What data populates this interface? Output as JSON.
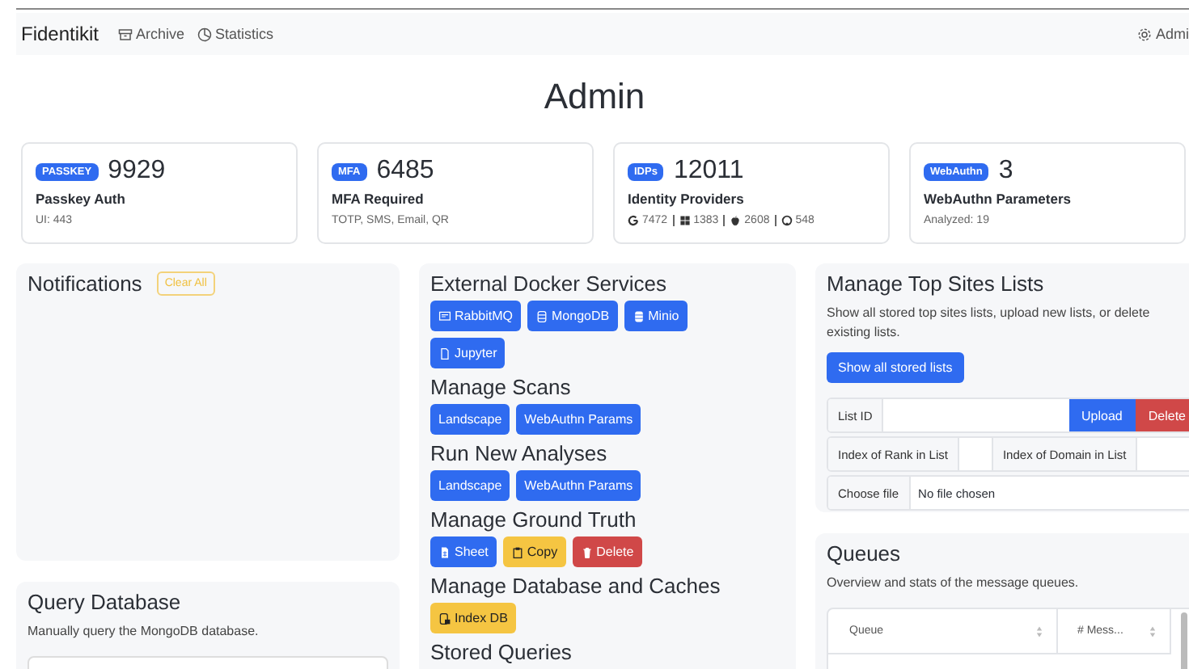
{
  "nav": {
    "brand": "Fidentikit",
    "links": [
      {
        "label": "Archive"
      },
      {
        "label": "Statistics"
      }
    ],
    "user": {
      "label": "Admi"
    }
  },
  "title": "Admin",
  "stats": [
    {
      "badge": "PASSKEY",
      "value": "9929",
      "label": "Passkey Auth",
      "sub": {
        "kind": "text",
        "text": "UI: 443"
      }
    },
    {
      "badge": "MFA",
      "value": "6485",
      "label": "MFA Required",
      "sub": {
        "kind": "text",
        "text": "TOTP, SMS, Email, QR"
      }
    },
    {
      "badge": "IDPs",
      "value": "12011",
      "label": "Identity Providers",
      "sub": {
        "kind": "providers",
        "items": [
          {
            "count": "7472"
          },
          {
            "count": "1383"
          },
          {
            "count": "2608"
          },
          {
            "count": "548"
          }
        ]
      }
    },
    {
      "badge": "WebAuthn",
      "value": "3",
      "label": "WebAuthn Parameters",
      "sub": {
        "kind": "text",
        "text": "Analyzed: 19"
      }
    }
  ],
  "notifications": {
    "title": "Notifications",
    "clear_button": "Clear All"
  },
  "query_db": {
    "title": "Query Database",
    "description": "Manually query the MongoDB database."
  },
  "sections": [
    {
      "title": "External Docker Services",
      "buttons": [
        {
          "label": "RabbitMQ"
        },
        {
          "label": "MongoDB"
        },
        {
          "label": "Minio"
        },
        {
          "label": "Jupyter"
        }
      ]
    },
    {
      "title": "Manage Scans",
      "buttons": [
        {
          "label": "Landscape"
        },
        {
          "label": "WebAuthn Params"
        }
      ]
    },
    {
      "title": "Run New Analyses",
      "buttons": [
        {
          "label": "Landscape"
        },
        {
          "label": "WebAuthn Params"
        }
      ]
    },
    {
      "title": "Manage Ground Truth",
      "buttons": [
        {
          "label": "Sheet"
        },
        {
          "label": "Copy"
        },
        {
          "label": "Delete"
        }
      ]
    },
    {
      "title": "Manage Database and Caches",
      "buttons": [
        {
          "label": "Index DB"
        }
      ]
    },
    {
      "title": "Stored Queries"
    }
  ],
  "top_sites": {
    "title": "Manage Top Sites Lists",
    "description": "Show all stored top sites lists, upload new lists, or delete existing lists.",
    "show_button": "Show all stored lists",
    "list_id_label": "List ID",
    "upload_button": "Upload",
    "delete_button": "Delete",
    "rank_label": "Index of Rank in List",
    "domain_label": "Index of Domain in List",
    "choose_file": "Choose file",
    "no_file": "No file chosen"
  },
  "queues": {
    "title": "Queues",
    "description": "Overview and stats of the message queues.",
    "columns": [
      "Queue",
      "# Mess..."
    ]
  }
}
